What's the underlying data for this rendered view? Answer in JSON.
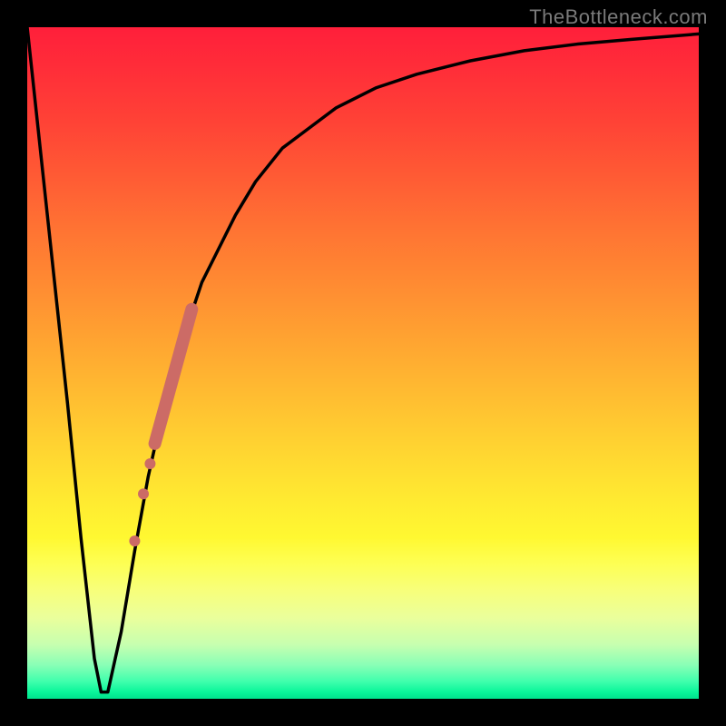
{
  "watermark": "TheBottleneck.com",
  "colors": {
    "curve_stroke": "#000000",
    "marker_fill": "#cc6b66",
    "marker_stroke": "#cc6b66"
  },
  "chart_data": {
    "type": "line",
    "title": "",
    "xlabel": "",
    "ylabel": "",
    "xlim": [
      0,
      100
    ],
    "ylim": [
      0,
      100
    ],
    "grid": false,
    "legend": false,
    "series": [
      {
        "name": "bottleneck-curve",
        "x": [
          0,
          3,
          6,
          8,
          10,
          11,
          12,
          14,
          16,
          18,
          20,
          22,
          24,
          26,
          28,
          31,
          34,
          38,
          42,
          46,
          52,
          58,
          66,
          74,
          82,
          90,
          100
        ],
        "y": [
          100,
          72,
          44,
          24,
          6,
          1,
          1,
          10,
          22,
          33,
          42,
          50,
          56,
          62,
          66,
          72,
          77,
          82,
          85,
          88,
          91,
          93,
          95,
          96.5,
          97.5,
          98.2,
          99
        ]
      }
    ],
    "markers": [
      {
        "name": "thick-segment",
        "shape": "line",
        "x0": 19.0,
        "y0": 38.0,
        "x1": 24.5,
        "y1": 58.0,
        "width": 14
      },
      {
        "name": "dot-1",
        "shape": "circle",
        "x": 18.3,
        "y": 35.0,
        "r": 6
      },
      {
        "name": "dot-2",
        "shape": "circle",
        "x": 17.3,
        "y": 30.5,
        "r": 6
      },
      {
        "name": "dot-3",
        "shape": "circle",
        "x": 16.0,
        "y": 23.5,
        "r": 6
      }
    ]
  }
}
